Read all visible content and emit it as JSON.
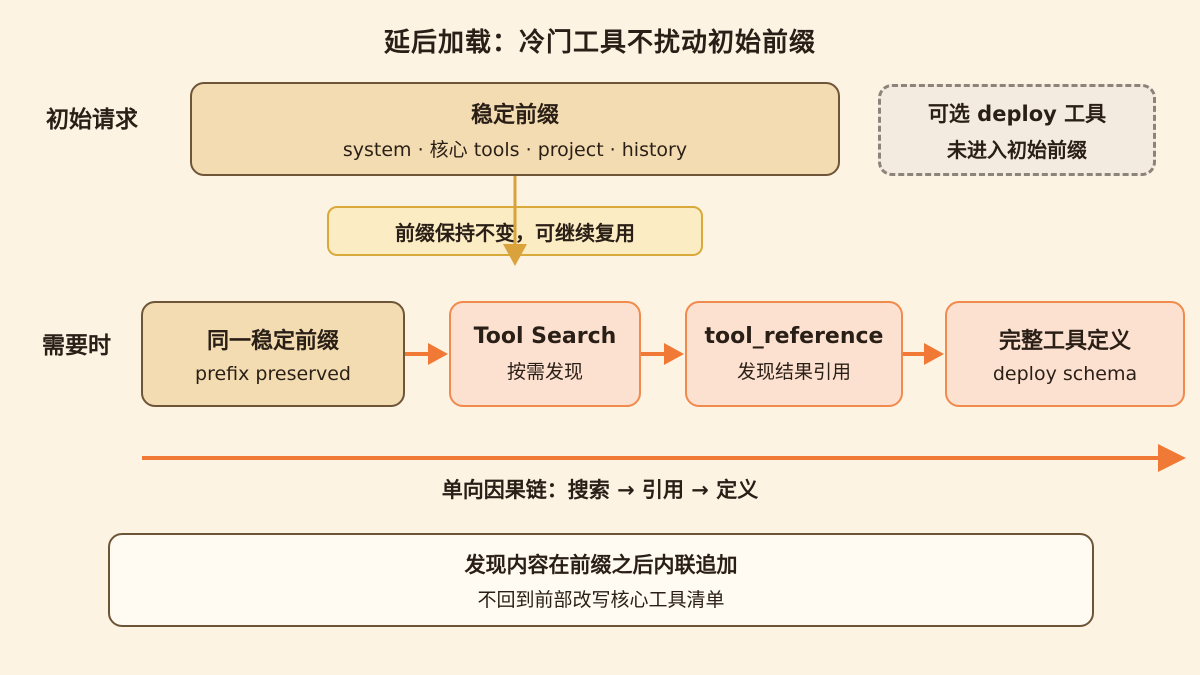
{
  "title": "延后加载：冷门工具不扰动初始前缀",
  "rows": {
    "initial_label": "初始请求",
    "needed_label": "需要时"
  },
  "stable_prefix": {
    "title": "稳定前缀",
    "subtitle": "system · 核心 tools · project · history"
  },
  "optional_tools": {
    "title": "可选 deploy 工具",
    "subtitle": "未进入初始前缀"
  },
  "reuse_note": "前缀保持不变，可继续复用",
  "flow": [
    {
      "title": "同一稳定前缀",
      "subtitle": "prefix preserved"
    },
    {
      "title": "Tool Search",
      "subtitle": "按需发现"
    },
    {
      "title": "tool_reference",
      "subtitle": "发现结果引用"
    },
    {
      "title": "完整工具定义",
      "subtitle": "deploy schema"
    }
  ],
  "chain_label": "单向因果链：搜索 → 引用 → 定义",
  "bottom_note": {
    "title": "发现内容在前缀之后内联追加",
    "subtitle": "不回到前部改写核心工具清单"
  },
  "colors": {
    "accent_orange": "#f07a35",
    "gold": "#d9a23a",
    "brown_border": "#6e5538",
    "tan_fill": "#f3dcb2",
    "peach_fill": "#fde1d0",
    "background": "#fdf3e3"
  }
}
